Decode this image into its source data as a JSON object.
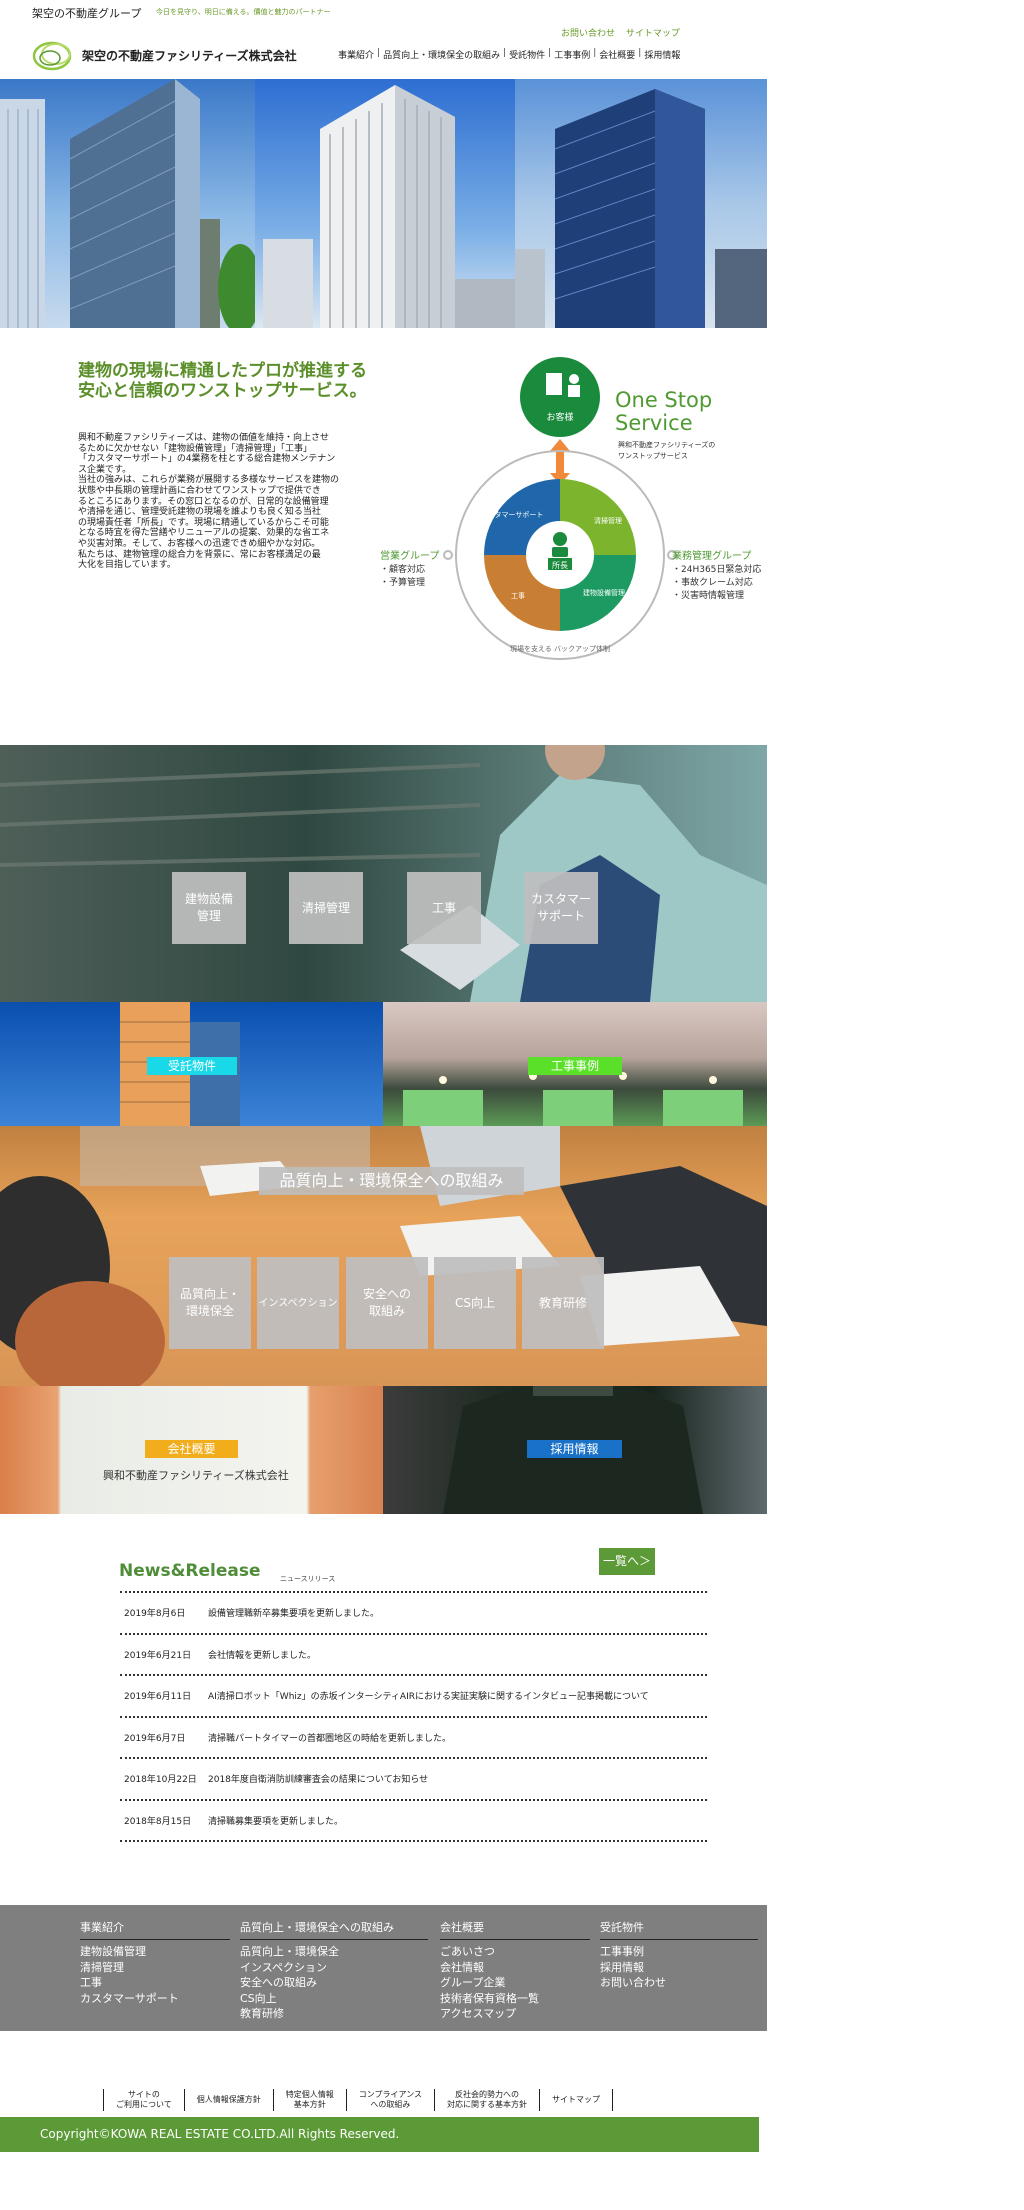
{
  "header": {
    "group_name": "架空の不動産グループ",
    "tagline": "今日を見守り、明日に備える。價值と魅力のパートナー",
    "utility_links": [
      "お問い合わせ",
      "サイトマップ"
    ],
    "company_name": "架空の不動産ファシリティーズ株式会社",
    "nav": [
      "事業紹介",
      "品質向上・環境保全の取組み",
      "受託物件",
      "工事事例",
      "会社概要",
      "採用情報"
    ]
  },
  "onestop": {
    "lead_line1": "建物の現場に精通したプロが推進する",
    "lead_line2": "安心と信頼のワンストップサービス。",
    "desc_lines": [
      "興和不動産ファシリティーズは、建物の価値を維持・向上させ",
      "るために欠かせない「建物設備管理」「清掃管理」「工事」",
      "「カスタマーサポート」の4業務を柱とする総合建物メンテナン",
      "ス企業です。",
      "当社の強みは、これらが業務が展開する多様なサービスを建物の",
      "状態や中長期の管理計画に合わせてワンストップで提供でき",
      "るところにあります。その窓口となるのが、日常的な設備管理",
      "や清掃を通じ、管理受託建物の現場を誰よりも良く知る当社",
      "の現場責任者「所長」です。現場に精通しているからこそ可能",
      "となる時宜を得た営繕やリニューアルの提案、効果的な省エネ",
      "や災害対策。そして、お客様への迅速できめ細やかな対応。",
      "私たちは、建物管理の総合力を背景に、常にお客様満足の最",
      "大化を目指しています。"
    ],
    "diagram": {
      "customer": "お客様",
      "title_line1": "One Stop",
      "title_line2": "Service",
      "subtitle_line1": "興和不動産ファシリティーズの",
      "subtitle_line2": "ワンストップサービス",
      "center": "所長",
      "segments": [
        "カスタマーサポート",
        "清掃管理",
        "工事",
        "建物設備管理"
      ],
      "ring_text": "現場を支える バックアップ体制",
      "left_group_title": "営業グループ",
      "left_group_items": [
        "・顧客対応",
        "・予算管理"
      ],
      "right_group_title": "業務管理グループ",
      "right_group_items": [
        "・24H365日緊急対応",
        "・事故クレーム対応",
        "・災害時情報管理"
      ]
    }
  },
  "services": [
    "建物設備\n管理",
    "清掃管理",
    "工事",
    "カスタマー\nサポート"
  ],
  "tiles": {
    "properties": "受託物件",
    "works": "工事事例",
    "quality_title": "品質向上・環境保全への取組み",
    "quality_items": [
      "品質向上・\n環境保全",
      "インスペクション",
      "安全への\n取組み",
      "CS向上",
      "教育研修"
    ],
    "company_label": "会社概要",
    "company_name": "興和不動産ファシリティーズ株式会社",
    "recruit": "採用情報"
  },
  "news": {
    "title": "News&Release",
    "subtitle": "ニュースリリース",
    "all_button": "一覧へ＞",
    "items": [
      {
        "date": "2019年8月6日",
        "text": "設備管理職新卒募集要項を更新しました。"
      },
      {
        "date": "2019年6月21日",
        "text": "会社情報を更新しました。"
      },
      {
        "date": "2019年6月11日",
        "text": "AI清掃ロボット「Whiz」の赤坂インターシティAIRにおける実証実験に関するインタビュー記事掲載について"
      },
      {
        "date": "2019年6月7日",
        "text": "清掃職パートタイマーの首都圏地区の時給を更新しました。"
      },
      {
        "date": "2018年10月22日",
        "text": "2018年度自衛消防訓練審査会の結果についてお知らせ"
      },
      {
        "date": "2018年8月15日",
        "text": "清掃職募集要項を更新しました。"
      }
    ]
  },
  "footer": {
    "columns": [
      {
        "heading": "事業紹介",
        "items": [
          "建物設備管理",
          "清掃管理",
          "工事",
          "カスタマーサポート"
        ]
      },
      {
        "heading": "品質向上・環境保全への取組み",
        "items": [
          "品質向上・環境保全",
          "インスペクション",
          "安全への取組み",
          "CS向上",
          "教育研修"
        ]
      },
      {
        "heading": "会社概要",
        "items": [
          "ごあいさつ",
          "会社情報",
          "グループ企業",
          "技術者保有資格一覧",
          "アクセスマップ"
        ]
      },
      {
        "heading": "受託物件",
        "items": [
          "工事事例",
          "採用情報",
          "お問い合わせ"
        ]
      }
    ],
    "policy_links": [
      "サイトの\nご利用について",
      "個人情報保護方針",
      "特定個人情報\n基本方針",
      "コンプライアンス\nへの取組み",
      "反社会的勢力への\n対応に関する基本方針",
      "サイトマップ"
    ],
    "copyright": "Copyright©KOWA REAL ESTATE CO.LTD.All Rights Reserved."
  },
  "colors": {
    "brand_green": "#5b9a36",
    "lead_green": "#5b8f2a",
    "footer_gray": "#7f7f7f"
  }
}
